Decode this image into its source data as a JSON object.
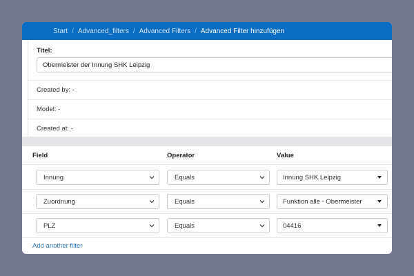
{
  "breadcrumb": {
    "items": [
      "Start",
      "Advanced_filters",
      "Advanced Filters"
    ],
    "current": "Advanced Filter hinzufügen",
    "separator": "/"
  },
  "form": {
    "title_label": "Titel:",
    "title_value": "Obermeister der Innung SHK Leipzig",
    "created_by": "Created by: -",
    "model": "Model: -",
    "created_at": "Created at: -"
  },
  "filters": {
    "headers": {
      "field": "Field",
      "operator": "Operator",
      "value": "Value"
    },
    "rows": [
      {
        "field": "Innung",
        "operator": "Equals",
        "value": "Innung SHK Leipzig"
      },
      {
        "field": "Zuordnung",
        "operator": "Equals",
        "value": "Funktion alle - Obermeister"
      },
      {
        "field": "PLZ",
        "operator": "Equals",
        "value": "04416"
      }
    ],
    "add_label": "Add another filter"
  },
  "colors": {
    "accent": "#0b6dc2",
    "background": "#737a90",
    "link": "#2a78c5"
  }
}
